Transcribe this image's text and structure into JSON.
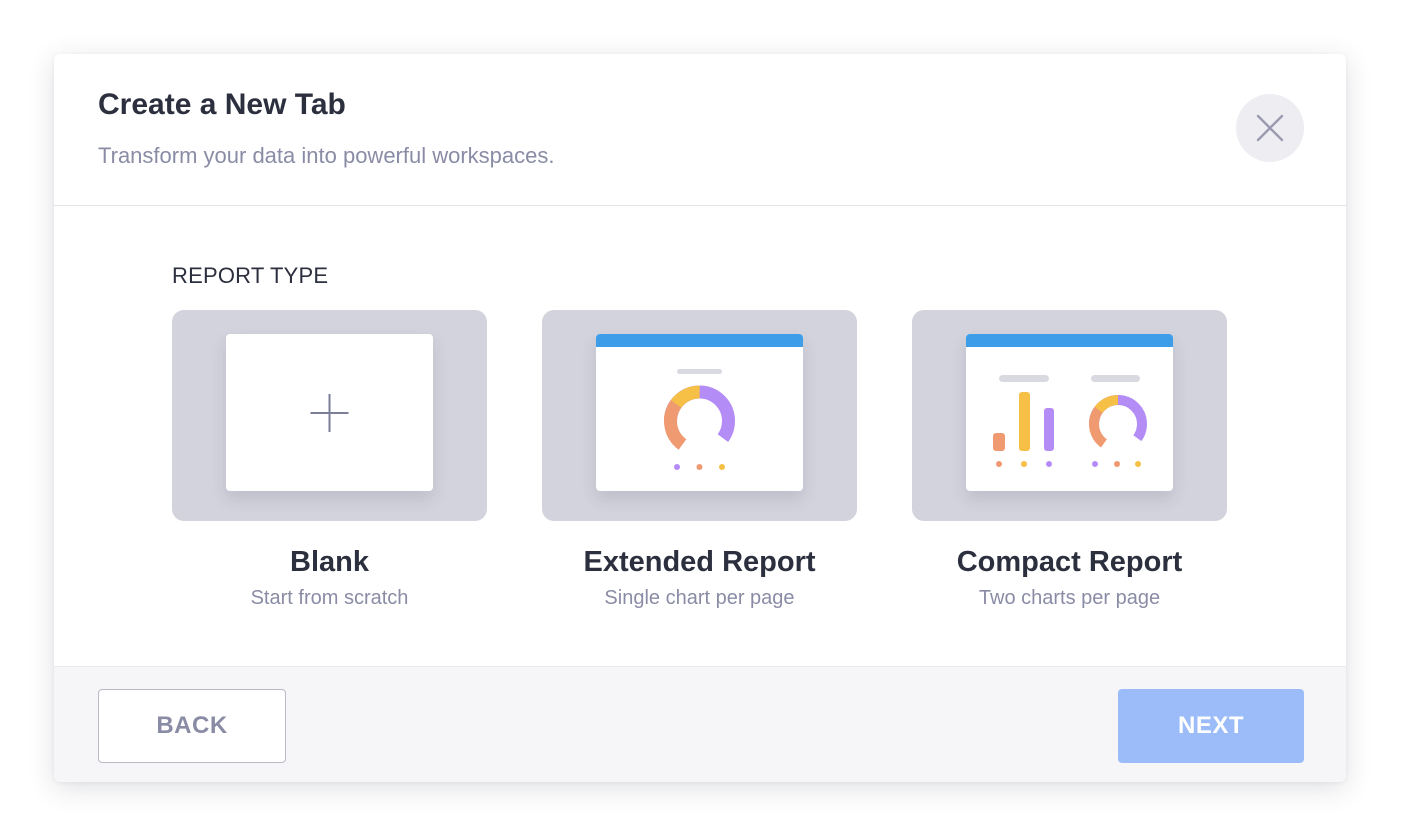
{
  "dialog": {
    "title": "Create a New Tab",
    "subtitle": "Transform your data into powerful workspaces."
  },
  "section": {
    "label": "REPORT TYPE"
  },
  "cards": [
    {
      "title": "Blank",
      "description": "Start from scratch",
      "icon": "plus-icon"
    },
    {
      "title": "Extended Report",
      "description": "Single chart per page",
      "icon": "single-chart-preview-icon"
    },
    {
      "title": "Compact Report",
      "description": "Two charts per page",
      "icon": "two-charts-preview-icon"
    }
  ],
  "footer": {
    "back_label": "BACK",
    "next_label": "NEXT"
  },
  "colors": {
    "accent_blue": "#3d9de8",
    "next_button_disabled": "#9bbcf8",
    "chart_purple": "#b48cf6",
    "chart_orange": "#ef9a70",
    "chart_yellow": "#f6bf45",
    "thumbnail_bg": "#d3d3dd"
  }
}
